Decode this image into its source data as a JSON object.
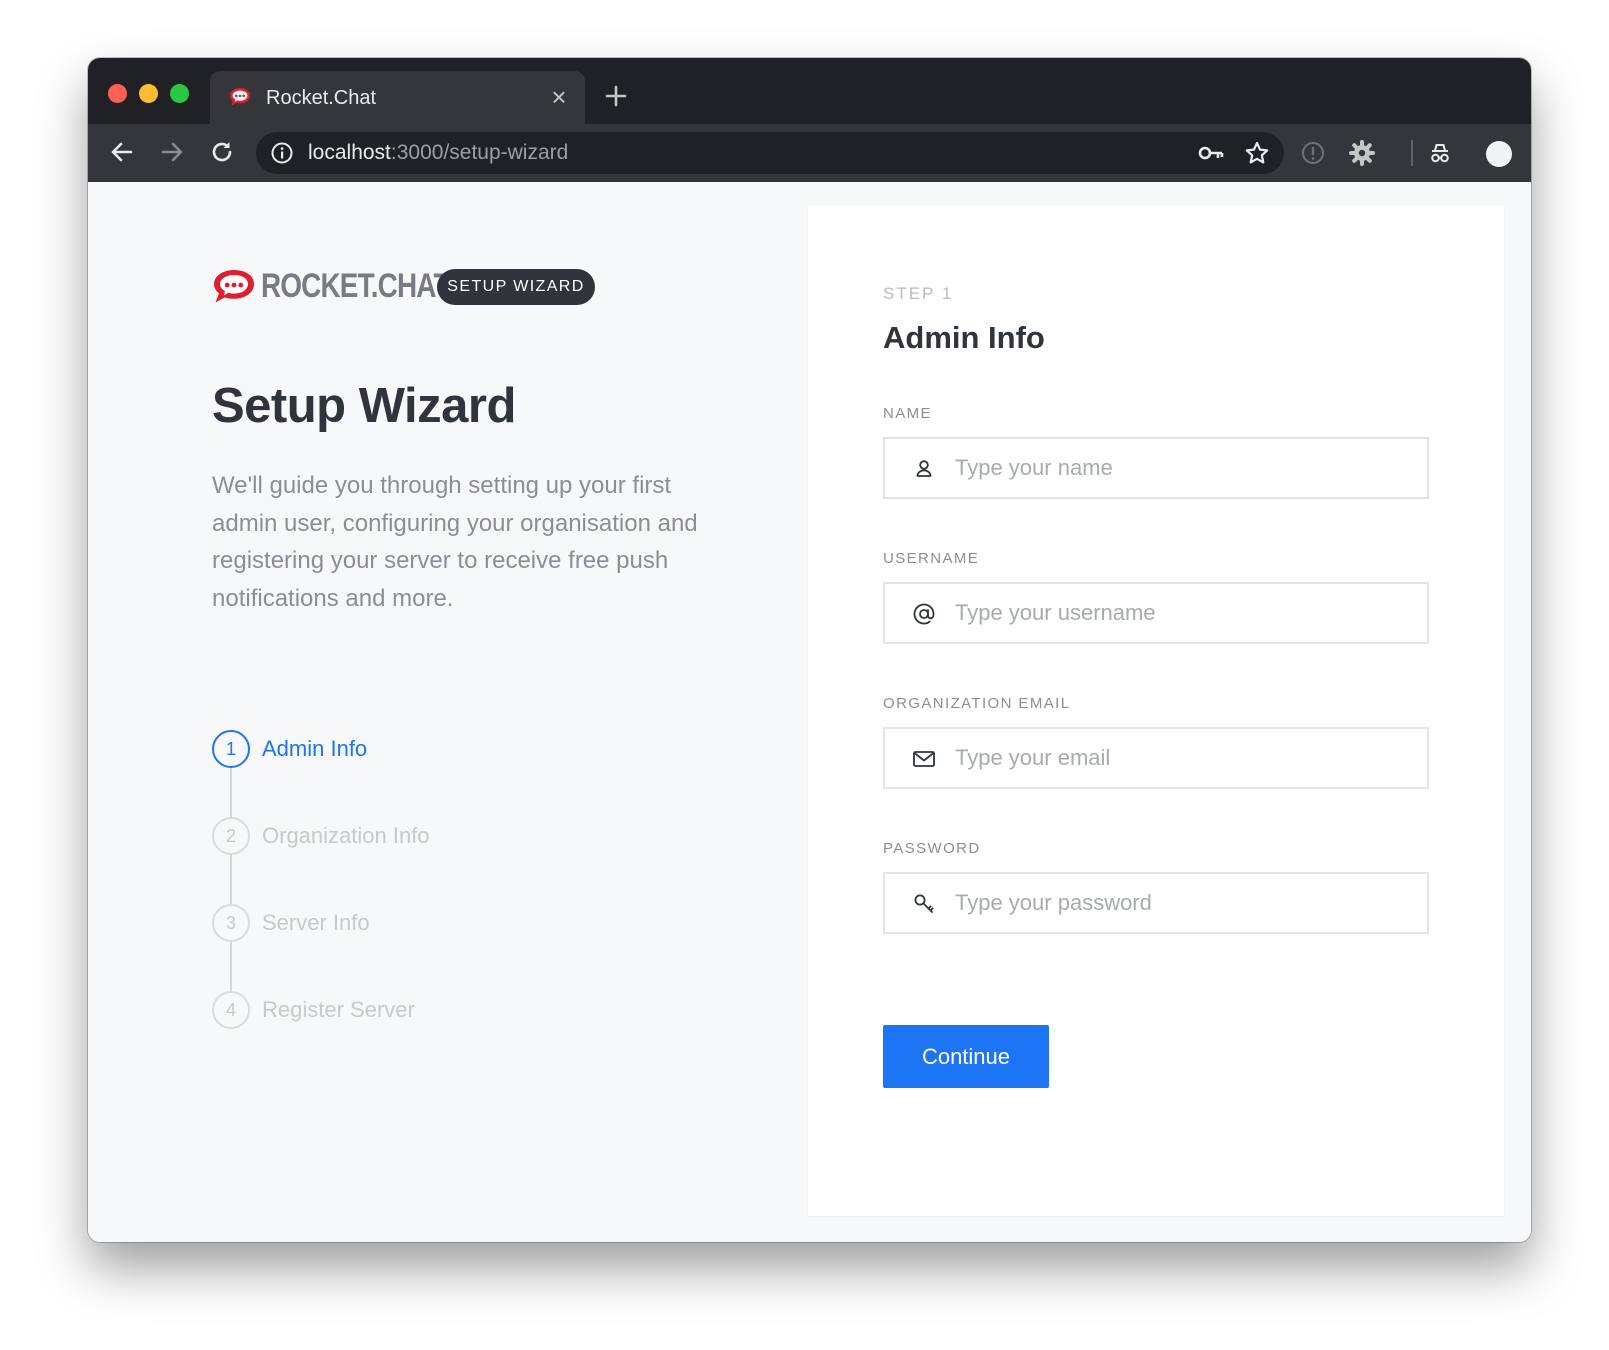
{
  "browser": {
    "tab_title": "Rocket.Chat",
    "url_host": "localhost",
    "url_path": ":3000/setup-wizard"
  },
  "icons": {
    "back": "arrow-left-icon",
    "forward": "arrow-right-icon",
    "reload": "reload-icon",
    "site_info": "info-icon",
    "password_key": "key-icon",
    "bookmark": "star-icon",
    "extension": "extension-icon",
    "settings": "gear-icon",
    "incognito": "incognito-icon",
    "profile": "avatar"
  },
  "colors": {
    "accent": "#1d74f5",
    "dark": "#2f343d",
    "brand_red": "#e01e2f"
  },
  "left": {
    "logo_text": "ROCKET.CHAT",
    "badge": "SETUP WIZARD",
    "title": "Setup Wizard",
    "description": "We'll guide you through setting up your first admin user, configuring your organisation and registering your server to receive free push notifications and more.",
    "steps": [
      {
        "number": "1",
        "label": "Admin Info",
        "active": true
      },
      {
        "number": "2",
        "label": "Organization Info",
        "active": false
      },
      {
        "number": "3",
        "label": "Server Info",
        "active": false
      },
      {
        "number": "4",
        "label": "Register Server",
        "active": false
      }
    ]
  },
  "form": {
    "step_tag": "STEP 1",
    "title": "Admin Info",
    "fields": {
      "name": {
        "label": "NAME",
        "placeholder": "Type your name",
        "value": ""
      },
      "username": {
        "label": "USERNAME",
        "placeholder": "Type your username",
        "value": ""
      },
      "email": {
        "label": "ORGANIZATION EMAIL",
        "placeholder": "Type your email",
        "value": ""
      },
      "password": {
        "label": "PASSWORD",
        "placeholder": "Type your password",
        "value": ""
      }
    },
    "continue_label": "Continue"
  }
}
